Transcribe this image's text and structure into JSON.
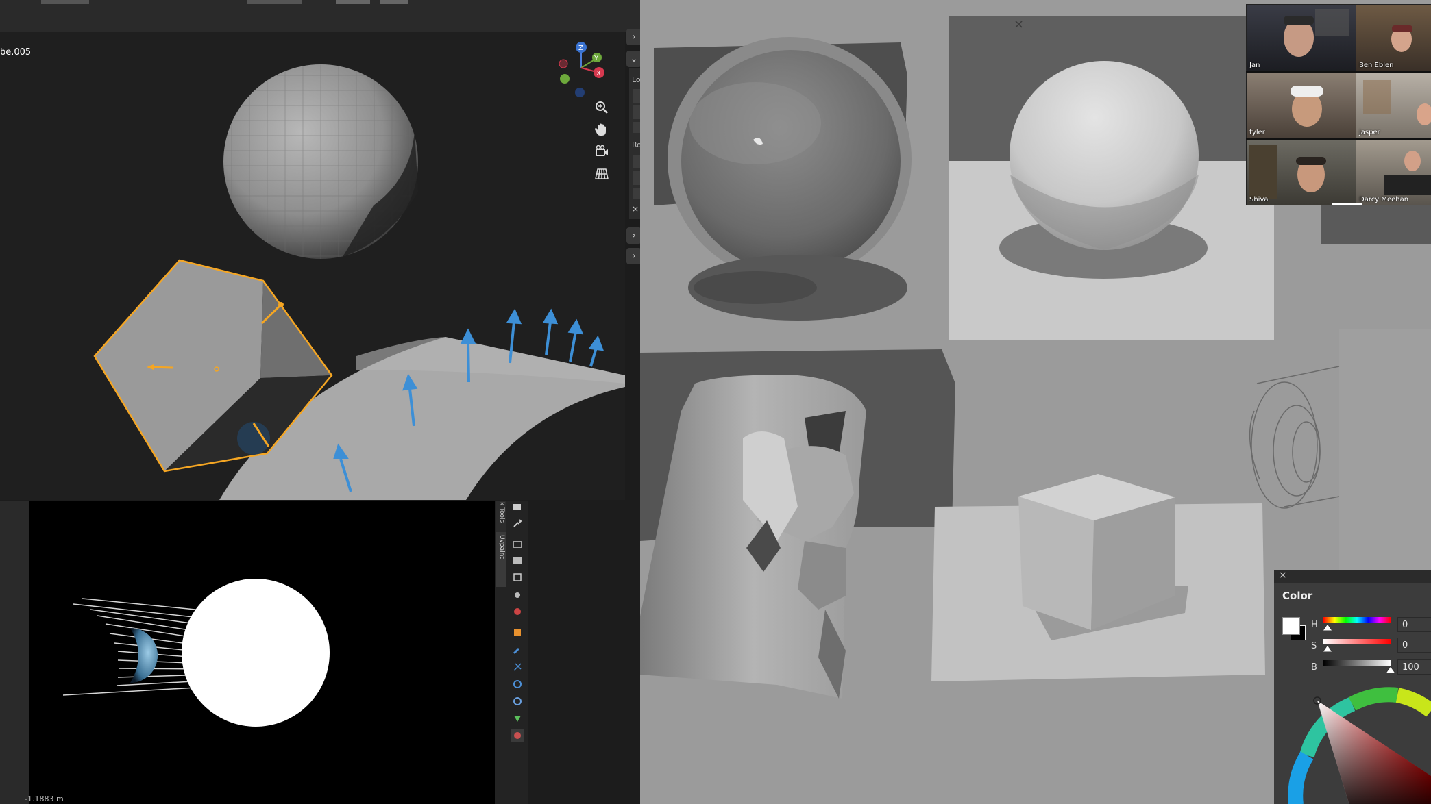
{
  "blender": {
    "object_name": "be.005",
    "header_items": [
      "Lo",
      "Ro"
    ],
    "tabs": [
      "k Tools",
      "Uvpaint"
    ],
    "bottom_readout": "-1.1883 m",
    "gizmo": {
      "z": "Z",
      "y": "Y",
      "x": "X"
    }
  },
  "video_call": {
    "participants": [
      {
        "name": "Jan"
      },
      {
        "name": "Ben Eblen"
      },
      {
        "name": "tyler"
      },
      {
        "name": "jasper"
      },
      {
        "name": "Shiva"
      },
      {
        "name": "Darcy Meehan"
      }
    ]
  },
  "paint": {
    "close_glyph": "×",
    "color_panel": {
      "title": "Color",
      "close_glyph": "×",
      "h_label": "H",
      "h_value": "0",
      "s_label": "S",
      "s_value": "0",
      "b_label": "B",
      "b_value": "100",
      "h": 0,
      "s": 0,
      "b": 100
    }
  },
  "colors": {
    "blender_bg": "#1f1f1f",
    "selection_orange": "#f5a623",
    "normal_blue": "#3d8fd6",
    "canvas_grey": "#9b9b9b"
  }
}
